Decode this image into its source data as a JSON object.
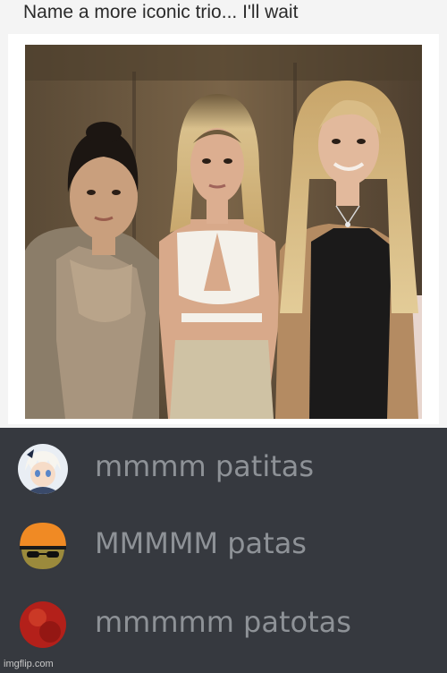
{
  "meme": {
    "caption": "Name a more iconic trio... I'll wait"
  },
  "chat": {
    "messages": [
      {
        "text": "mmmm patitas",
        "avatar_icon": "anime-character-avatar-icon"
      },
      {
        "text": "MMMMM patas",
        "avatar_icon": "orange-helmet-sunglasses-avatar-icon"
      },
      {
        "text": "mmmmm patotas",
        "avatar_icon": "red-ball-avatar-icon"
      }
    ],
    "background_color": "#36393f",
    "text_color": "#8e9297"
  },
  "watermark": "imgflip.com"
}
